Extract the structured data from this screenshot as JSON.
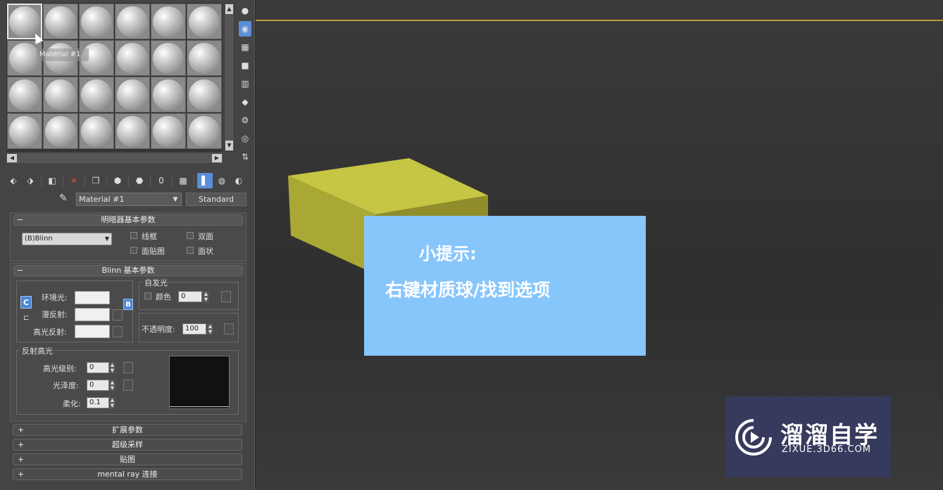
{
  "editor": {
    "slots_count": 24,
    "active_slot_tooltip": "Material #1",
    "material_name": "Material #1",
    "material_type": "Standard",
    "shader_rollout": {
      "title": "明暗器基本参数",
      "shader": "(B)Blinn",
      "opt_wire": "线框",
      "opt_2sided": "双面",
      "opt_facemap": "面贴图",
      "opt_faceted": "面状"
    },
    "blinn_rollout": {
      "title": "Blinn 基本参数",
      "ambient": "环境光:",
      "diffuse": "漫反射:",
      "specular": "高光反射:",
      "self_illum_group": "自发光",
      "self_illum_color": "颜色",
      "self_illum_value": "0",
      "opacity_label": "不透明度:",
      "opacity_value": "100",
      "lock_c": "C",
      "lock_b": "B",
      "spec_group": "反射高光",
      "spec_level_label": "高光级别:",
      "spec_level_value": "0",
      "gloss_label": "光泽度:",
      "gloss_value": "0",
      "soften_label": "柔化:",
      "soften_value": "0.1"
    },
    "collapsed_rollouts": [
      "扩展参数",
      "超级采样",
      "贴图",
      "mental ray 连接"
    ]
  },
  "hint": {
    "title": "小提示:",
    "body": "右键材质球/找到选项"
  },
  "logo": {
    "name": "溜溜自学",
    "url": "ZIXUE.3D66.COM"
  },
  "colors": {
    "box_top": "#c6c544",
    "box_front": "#a9a834",
    "box_side": "#8f8e2a",
    "hint_bg": "#87c6fb",
    "logo_bg": "#363a5c"
  }
}
